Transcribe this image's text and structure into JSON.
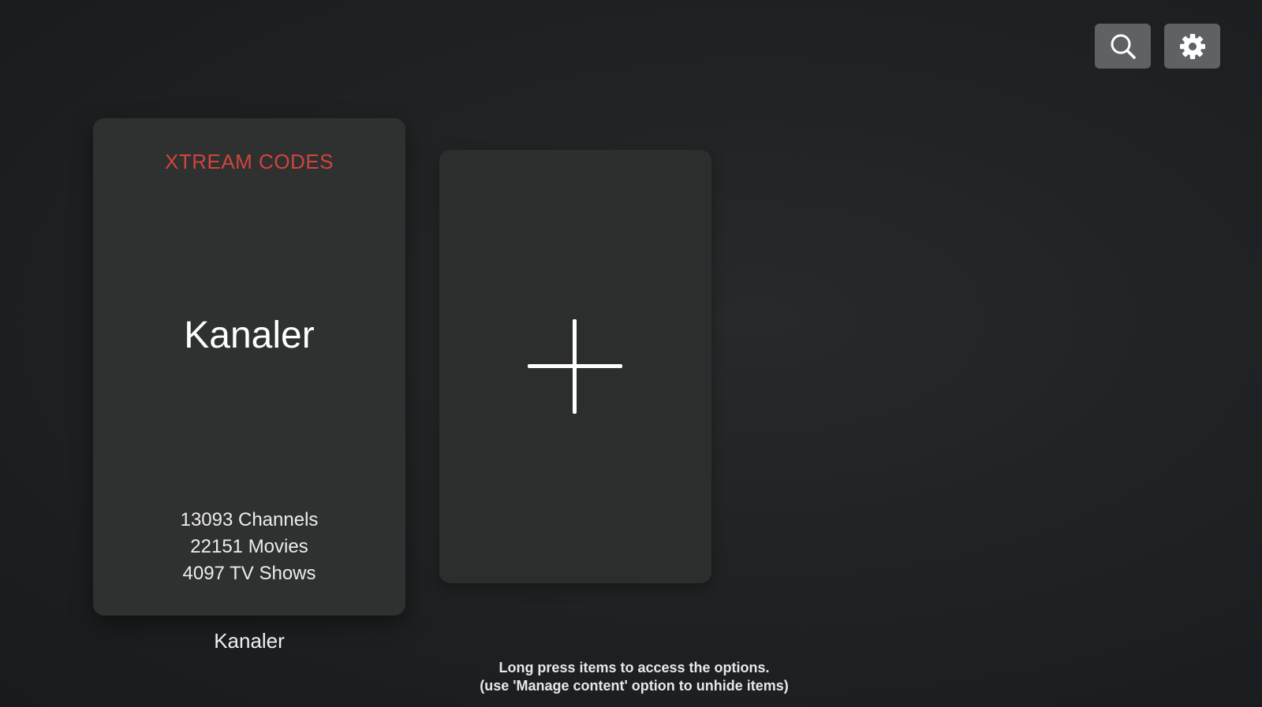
{
  "toolbar": {
    "search_icon": "search-icon",
    "settings_icon": "gear-icon"
  },
  "playlists": [
    {
      "provider": "XTREAM CODES",
      "title": "Kanaler",
      "stats": {
        "channels": "13093 Channels",
        "movies": "22151 Movies",
        "tv_shows": "4097 TV Shows"
      },
      "caption": "Kanaler"
    }
  ],
  "add_card": {
    "icon": "plus-icon"
  },
  "hint": {
    "line1": "Long press items to access the options.",
    "line2": "(use 'Manage content' option to unhide items)"
  },
  "colors": {
    "background": "#1f2324",
    "card": "#2f3130",
    "provider_accent": "#d0443d",
    "button": "#5f6265"
  }
}
